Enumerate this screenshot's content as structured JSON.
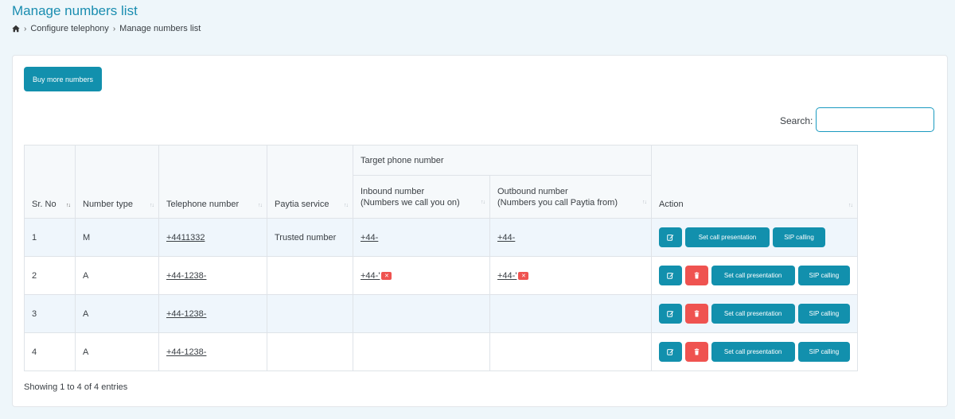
{
  "header": {
    "title": "Manage numbers list",
    "breadcrumb": [
      "Configure telephony",
      "Manage numbers list"
    ]
  },
  "toolbar": {
    "buy_label": "Buy more numbers",
    "search_label": "Search:",
    "search_value": ""
  },
  "table": {
    "columns": {
      "sr_no": "Sr. No",
      "number_type": "Number type",
      "telephone_number": "Telephone number",
      "paytia_service": "Paytia service",
      "target_group": "Target phone number",
      "inbound_line1": "Inbound number",
      "inbound_line2": "(Numbers we call you on)",
      "outbound_line1": "Outbound number",
      "outbound_line2": "(Numbers you call Paytia from)",
      "action": "Action"
    },
    "rows": [
      {
        "sr": "1",
        "type": "M",
        "telephone": "+4411332",
        "service": "Trusted number",
        "inbound": "+44-",
        "outbound": "+44-",
        "inbound_remove": false,
        "outbound_remove": false,
        "deletable": false
      },
      {
        "sr": "2",
        "type": "A",
        "telephone": "+44-1238-",
        "service": "",
        "inbound": "+44-'",
        "outbound": "+44-'",
        "inbound_remove": true,
        "outbound_remove": true,
        "deletable": true
      },
      {
        "sr": "3",
        "type": "A",
        "telephone": "+44-1238-",
        "service": "",
        "inbound": "",
        "outbound": "",
        "inbound_remove": false,
        "outbound_remove": false,
        "deletable": true
      },
      {
        "sr": "4",
        "type": "A",
        "telephone": "+44-1238-",
        "service": "",
        "inbound": "",
        "outbound": "",
        "inbound_remove": false,
        "outbound_remove": false,
        "deletable": true
      }
    ],
    "actions": {
      "set_call_label": "Set call presentation",
      "sip_label": "SIP calling"
    }
  },
  "footer": {
    "info": "Showing 1 to 4 of 4 entries"
  },
  "icons": {
    "home": "home-icon",
    "edit": "edit-icon",
    "delete": "trash-icon",
    "remove": "close-icon"
  },
  "colors": {
    "accent": "#1290ad",
    "danger": "#ef5350",
    "title": "#1a8db0"
  }
}
